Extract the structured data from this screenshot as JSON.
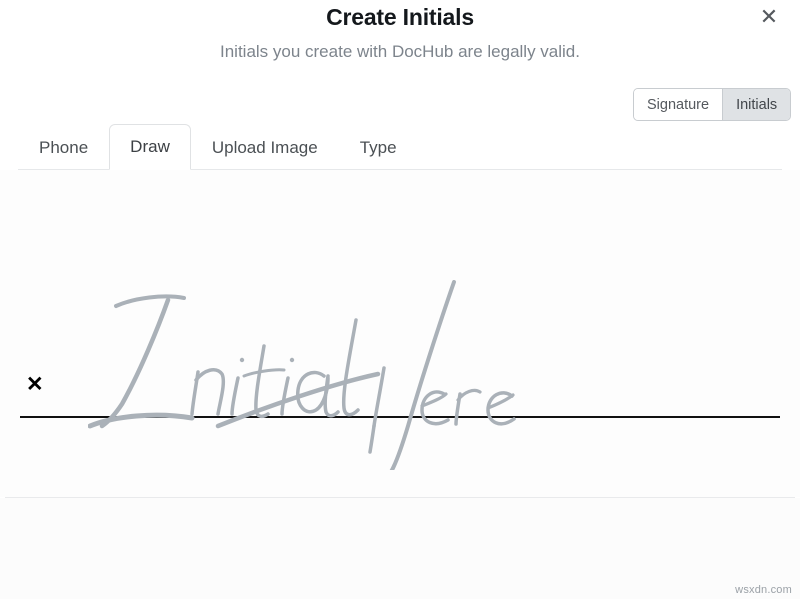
{
  "dialog": {
    "title": "Create Initials",
    "subtitle": "Initials you create with DocHub are legally valid.",
    "close_icon": "close-icon",
    "close_glyph": "✕"
  },
  "mode_toggle": {
    "options": [
      {
        "label": "Signature",
        "selected": false
      },
      {
        "label": "Initials",
        "selected": true
      }
    ]
  },
  "tabs": [
    {
      "label": "Phone",
      "active": false
    },
    {
      "label": "Draw",
      "active": true
    },
    {
      "label": "Upload Image",
      "active": false
    },
    {
      "label": "Type",
      "active": false
    }
  ],
  "draw_area": {
    "mark_glyph": "✕",
    "placeholder_text": "Initial Here",
    "placeholder_color": "#aab1b8",
    "line_color": "#111111"
  },
  "footer": {
    "watermark": "wsxdn.com"
  },
  "colors": {
    "title": "#14181c",
    "subtitle": "#7d848c",
    "selected_segment_bg": "#dfe2e5",
    "border": "#c8ccd0",
    "tab_border": "#e0e2e4"
  }
}
